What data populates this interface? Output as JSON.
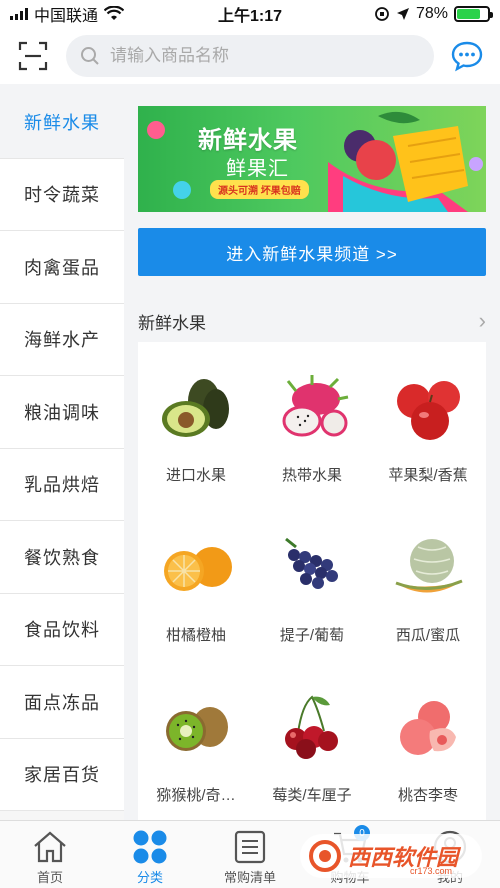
{
  "status_bar": {
    "carrier": "中国联通",
    "time": "上午1:17",
    "battery": "78%",
    "battery_level": 0.78
  },
  "top_bar": {
    "search_placeholder": "请输入商品名称",
    "scan_icon": "scan-icon",
    "message_icon": "chat-bubble-icon"
  },
  "sidebar": {
    "items": [
      {
        "label": "新鲜水果",
        "active": true
      },
      {
        "label": "时令蔬菜",
        "active": false
      },
      {
        "label": "肉禽蛋品",
        "active": false
      },
      {
        "label": "海鲜水产",
        "active": false
      },
      {
        "label": "粮油调味",
        "active": false
      },
      {
        "label": "乳品烘焙",
        "active": false
      },
      {
        "label": "餐饮熟食",
        "active": false
      },
      {
        "label": "食品饮料",
        "active": false
      },
      {
        "label": "面点冻品",
        "active": false
      },
      {
        "label": "家居百货",
        "active": false
      }
    ]
  },
  "banner": {
    "title": "新鲜水果",
    "subtitle": "鲜果汇",
    "tag": "源头可溯  坏果包赔"
  },
  "channel_button": "进入新鲜水果频道 >>",
  "section": {
    "title": "新鲜水果",
    "arrow": "›"
  },
  "categories": [
    {
      "label": "进口水果",
      "icon": "avocado-icon"
    },
    {
      "label": "热带水果",
      "icon": "dragon-fruit-icon"
    },
    {
      "label": "苹果梨/香蕉",
      "icon": "apple-icon"
    },
    {
      "label": "柑橘橙柚",
      "icon": "orange-icon"
    },
    {
      "label": "提子/葡萄",
      "icon": "grape-icon"
    },
    {
      "label": "西瓜/蜜瓜",
      "icon": "melon-icon"
    },
    {
      "label": "猕猴桃/奇…",
      "icon": "kiwi-icon"
    },
    {
      "label": "莓类/车厘子",
      "icon": "cherry-icon"
    },
    {
      "label": "桃杏李枣",
      "icon": "peach-icon"
    }
  ],
  "tab_bar": {
    "tabs": [
      {
        "label": "首页",
        "icon": "home-icon",
        "active": false
      },
      {
        "label": "分类",
        "icon": "category-icon",
        "active": true
      },
      {
        "label": "常购清单",
        "icon": "list-icon",
        "active": false
      },
      {
        "label": "购物车",
        "icon": "cart-icon",
        "active": false,
        "badge": "0"
      },
      {
        "label": "我的",
        "icon": "user-icon",
        "active": false
      }
    ]
  },
  "watermark": {
    "text": "西西软件园",
    "sub": "cr173.com"
  },
  "colors": {
    "accent": "#1a8be8",
    "battery": "#2bd24a"
  }
}
